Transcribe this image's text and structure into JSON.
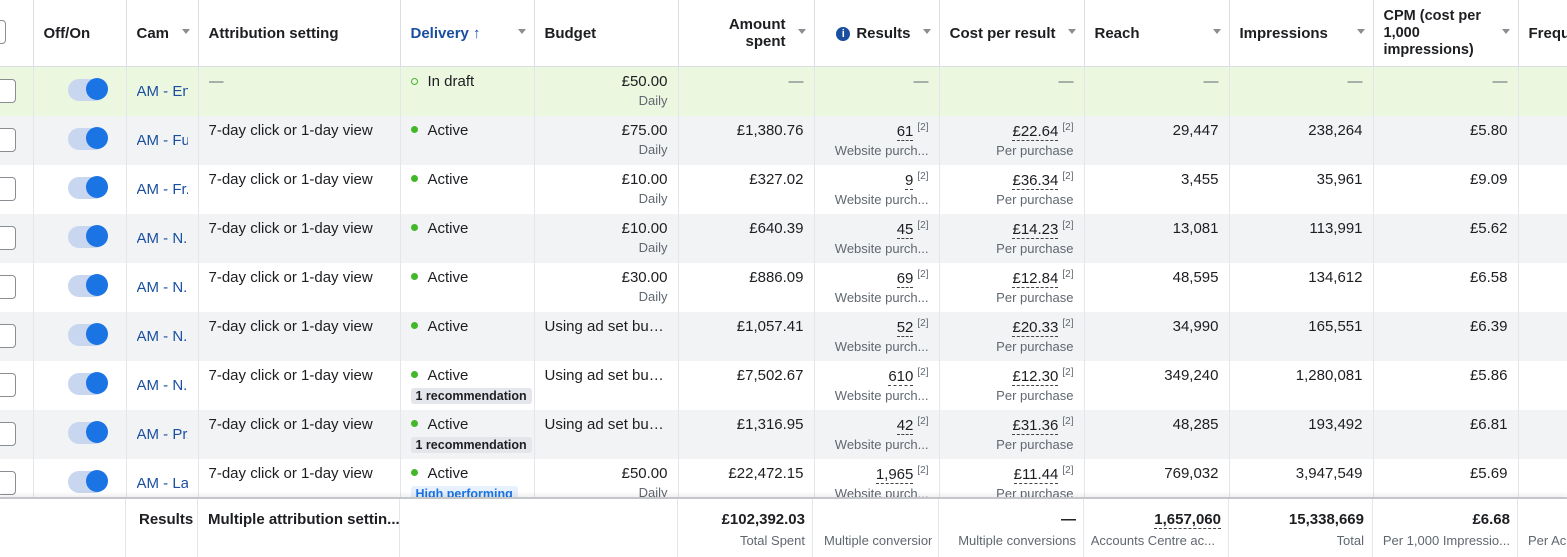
{
  "headers": {
    "offon": "Off/On",
    "campaign": "Cam",
    "attribution": "Attribution setting",
    "delivery": "Delivery ↑",
    "budget": "Budget",
    "amount_spent": "Amount spent",
    "results": "Results",
    "cost_per_result": "Cost per result",
    "reach": "Reach",
    "impressions": "Impressions",
    "cpm": "CPM (cost per 1,000 impressions)",
    "frequency": "Frequ"
  },
  "rows": [
    {
      "campaign": "AM - En...",
      "attribution": "—",
      "status": "In draft",
      "badge": "",
      "budget": "£50.00",
      "budget_sub": "Daily",
      "spent": "—",
      "results": "—",
      "results_sub": "",
      "cost": "—",
      "cost_sub": "",
      "reach": "—",
      "impressions": "—",
      "cpm": "—"
    },
    {
      "campaign": "AM - Fu...",
      "attribution": "7-day click or 1-day view",
      "status": "Active",
      "badge": "",
      "budget": "£75.00",
      "budget_sub": "Daily",
      "spent": "£1,380.76",
      "results": "61",
      "results_sub": "Website purch...",
      "cost": "£22.64",
      "cost_sub": "Per purchase",
      "reach": "29,447",
      "impressions": "238,264",
      "cpm": "£5.80"
    },
    {
      "campaign": "AM - Fr...",
      "attribution": "7-day click or 1-day view",
      "status": "Active",
      "badge": "",
      "budget": "£10.00",
      "budget_sub": "Daily",
      "spent": "£327.02",
      "results": "9",
      "results_sub": "Website purch...",
      "cost": "£36.34",
      "cost_sub": "Per purchase",
      "reach": "3,455",
      "impressions": "35,961",
      "cpm": "£9.09"
    },
    {
      "campaign": "AM - N...",
      "attribution": "7-day click or 1-day view",
      "status": "Active",
      "badge": "",
      "budget": "£10.00",
      "budget_sub": "Daily",
      "spent": "£640.39",
      "results": "45",
      "results_sub": "Website purch...",
      "cost": "£14.23",
      "cost_sub": "Per purchase",
      "reach": "13,081",
      "impressions": "113,991",
      "cpm": "£5.62"
    },
    {
      "campaign": "AM - N...",
      "attribution": "7-day click or 1-day view",
      "status": "Active",
      "badge": "",
      "budget": "£30.00",
      "budget_sub": "Daily",
      "spent": "£886.09",
      "results": "69",
      "results_sub": "Website purch...",
      "cost": "£12.84",
      "cost_sub": "Per purchase",
      "reach": "48,595",
      "impressions": "134,612",
      "cpm": "£6.58"
    },
    {
      "campaign": "AM - N...",
      "attribution": "7-day click or 1-day view",
      "status": "Active",
      "badge": "",
      "budget": "Using ad set bud...",
      "budget_sub": "",
      "spent": "£1,057.41",
      "results": "52",
      "results_sub": "Website purch...",
      "cost": "£20.33",
      "cost_sub": "Per purchase",
      "reach": "34,990",
      "impressions": "165,551",
      "cpm": "£6.39"
    },
    {
      "campaign": "AM - N...",
      "attribution": "7-day click or 1-day view",
      "status": "Active",
      "badge": "1 recommendation",
      "budget": "Using ad set bud...",
      "budget_sub": "",
      "spent": "£7,502.67",
      "results": "610",
      "results_sub": "Website purch...",
      "cost": "£12.30",
      "cost_sub": "Per purchase",
      "reach": "349,240",
      "impressions": "1,280,081",
      "cpm": "£5.86"
    },
    {
      "campaign": "AM - Pr...",
      "attribution": "7-day click or 1-day view",
      "status": "Active",
      "badge": "1 recommendation",
      "budget": "Using ad set bud...",
      "budget_sub": "",
      "spent": "£1,316.95",
      "results": "42",
      "results_sub": "Website purch...",
      "cost": "£31.36",
      "cost_sub": "Per purchase",
      "reach": "48,285",
      "impressions": "193,492",
      "cpm": "£6.81"
    },
    {
      "campaign": "AM - La...",
      "attribution": "7-day click or 1-day view",
      "status": "Active",
      "badge": "High performing",
      "budget": "£50.00",
      "budget_sub": "Daily",
      "spent": "£22,472.15",
      "results": "1,965",
      "results_sub": "Website purch...",
      "cost": "£11.44",
      "cost_sub": "Per purchase",
      "reach": "769,032",
      "impressions": "3,947,549",
      "cpm": "£5.69"
    }
  ],
  "footer": {
    "label": "Results",
    "attribution": "Multiple attribution settin...",
    "spent": "£102,392.03",
    "spent_sub": "Total Spent",
    "results_sub": "Multiple conversions",
    "cost": "—",
    "cost_sub": "Multiple conversions",
    "reach": "1,657,060",
    "reach_sub": "Accounts Centre ac...",
    "impressions": "15,338,669",
    "impressions_sub": "Total",
    "cpm": "£6.68",
    "cpm_sub": "Per 1,000 Impressio...",
    "freq_sub": "Per Ac"
  },
  "colors": {
    "link": "#1a4fa0",
    "toggle": "#1b74e4",
    "active_dot": "#42b72a",
    "draft_row": "#ecf7e0"
  }
}
